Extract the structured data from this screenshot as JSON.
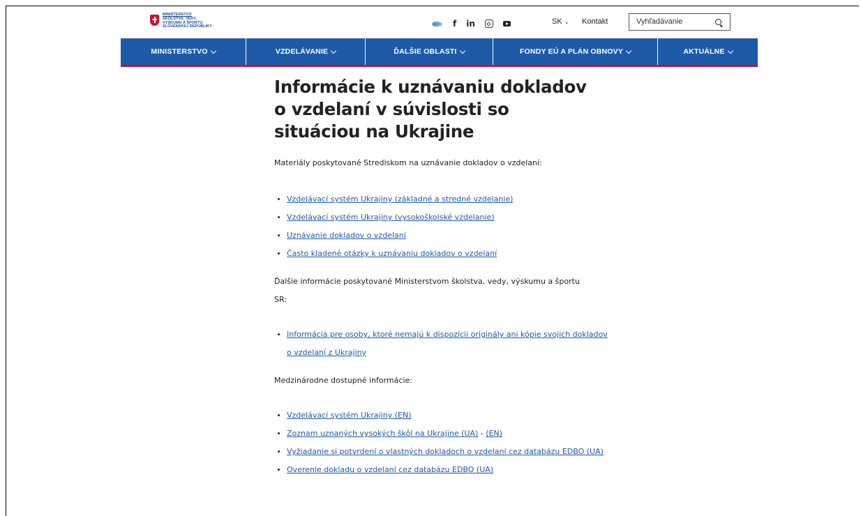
{
  "header": {
    "logo_lines": [
      "MINISTERSTVO",
      "ŠKOLSTVA, VEDY,",
      "VÝSKUMU A ŠPORTU",
      "SLOVENSKEJ REPUBLIKY"
    ],
    "social_icons": [
      "eu-flag-icon",
      "facebook-icon",
      "linkedin-icon",
      "instagram-icon",
      "youtube-icon"
    ],
    "facebook_glyph": "f",
    "linkedin_glyph": "in",
    "language": "SK",
    "contact_label": "Kontakt",
    "search_placeholder": "Vyhľadávanie"
  },
  "nav": {
    "items": [
      {
        "label": "MINISTERSTVO"
      },
      {
        "label": "VZDELÁVANIE"
      },
      {
        "label": "ĎALŠIE OBLASTI"
      },
      {
        "label": "FONDY EÚ A PLÁN OBNOVY"
      },
      {
        "label": "AKTUÁLNE"
      }
    ]
  },
  "colors": {
    "nav_bg": "#1e5aa8",
    "nav_underline": "#c8102e",
    "link": "#1e5aa8"
  },
  "article": {
    "title": "Informácie k uznávaniu dokladov o vzdelaní v súvislosti so situáciou na Ukrajine",
    "intro1": "Materiály poskytované Strediskom na uznávanie dokladov o vzdelaní:",
    "list1": [
      "Vzdelávací systém Ukrajiny (základné a stredné vzdelanie)",
      "Vzdelávací systém Ukrajiny (vysokoškolské vzdelanie)",
      "Uznávanie dokladov o vzdelaní",
      "Často kladené otázky k uznávaniu dokladov o vzdelaní"
    ],
    "intro2": "Ďalšie informácie poskytované Ministerstvom školstva, vedy, výskumu a športu SR:",
    "list2": [
      "Informácia pre osoby, ktoré nemajú k dispozícii originály ani kópie svojich dokladov o vzdelaní z Ukrajiny"
    ],
    "intro3": "Medzinárodne dostupné informácie:",
    "list3": {
      "item1": "Vzdelávací systém Ukrajiny (EN)",
      "item2_a": "Zoznam uznaných vysokých škôl na Ukrajine (UA)",
      "item2_sep": " - ",
      "item2_b": "(EN)",
      "item3": "Vyžiadanie si potvrdení o vlastných dokladoch o vzdelaní cez databázu EDBO (UA)",
      "item4": "Overenie dokladu o vzdelaní cez databázu EDBO (UA)"
    }
  }
}
